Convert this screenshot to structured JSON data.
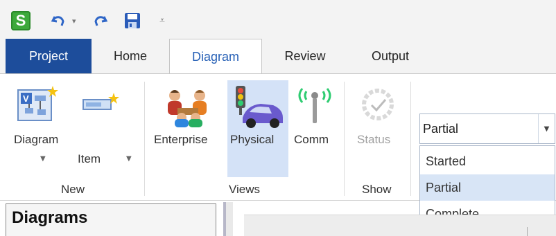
{
  "quick_access": {
    "icons": [
      "app-logo-icon",
      "undo-icon",
      "redo-icon",
      "save-icon",
      "customize-qat-icon"
    ],
    "logo_letter": "S"
  },
  "tabs": [
    "Project",
    "Home",
    "Diagram",
    "Review",
    "Output"
  ],
  "active_tab": "Diagram",
  "groups": {
    "new": {
      "label": "New",
      "diagram_label": "Diagram",
      "item_label": "Item"
    },
    "views": {
      "label": "Views",
      "enterprise_label": "Enterprise",
      "physical_label": "Physical",
      "comm_label": "Comm"
    },
    "show": {
      "label": "Show",
      "status_label": "Status"
    }
  },
  "status_combo": {
    "value": "Partial",
    "options": [
      "Started",
      "Partial",
      "Complete"
    ],
    "selected": "Partial"
  },
  "panel": {
    "title": "Diagrams"
  },
  "colors": {
    "project_tab": "#1d4d9b",
    "active_tab_text": "#2660b6",
    "highlight": "#d4e2f7",
    "logo_green": "#3da93b"
  }
}
